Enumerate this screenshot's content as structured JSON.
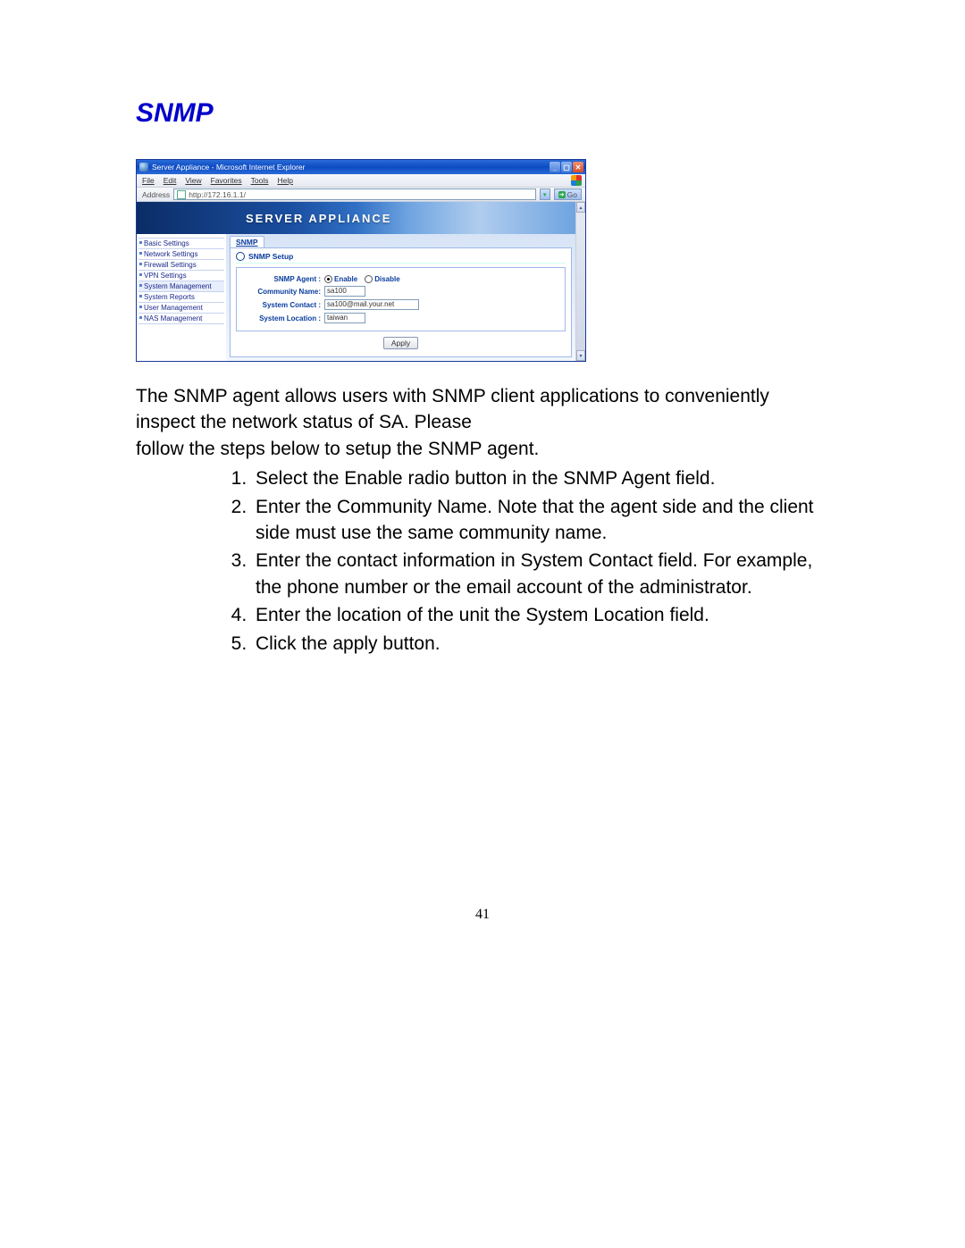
{
  "heading": "SNMP",
  "screenshot": {
    "window_title": "Server Appliance - Microsoft Internet Explorer",
    "menu": [
      "File",
      "Edit",
      "View",
      "Favorites",
      "Tools",
      "Help"
    ],
    "address_label": "Address",
    "address_value": "http://172.16.1.1/",
    "go_label": "Go",
    "banner_title": "SERVER APPLIANCE",
    "sidebar": [
      "Basic Settings",
      "Network Settings",
      "Firewall Settings",
      "VPN Settings",
      "System Management",
      "System Reports",
      "User Management",
      "NAS Management"
    ],
    "tab": "SNMP",
    "panel_title": "SNMP Setup",
    "form": {
      "agent_label": "SNMP Agent :",
      "enable": "Enable",
      "disable": "Disable",
      "community_label": "Community Name:",
      "community_value": "sa100",
      "contact_label": "System Contact :",
      "contact_value": "sa100@mail.your.net",
      "location_label": "System Location :",
      "location_value": "taiwan"
    },
    "apply": "Apply"
  },
  "para1": "The SNMP agent allows users with SNMP client applications to conveniently inspect the network status of SA. Please",
  "para2": "follow the steps below to setup the SNMP agent.",
  "steps": [
    "Select the Enable radio button in the SNMP Agent field.",
    "Enter the Community Name. Note that the agent side and the client side must use the same community name.",
    "Enter the contact information in System Contact field. For example, the phone number or the email account of the administrator.",
    "Enter the location of the unit the System Location field.",
    "Click the apply button."
  ],
  "page_number": "41"
}
